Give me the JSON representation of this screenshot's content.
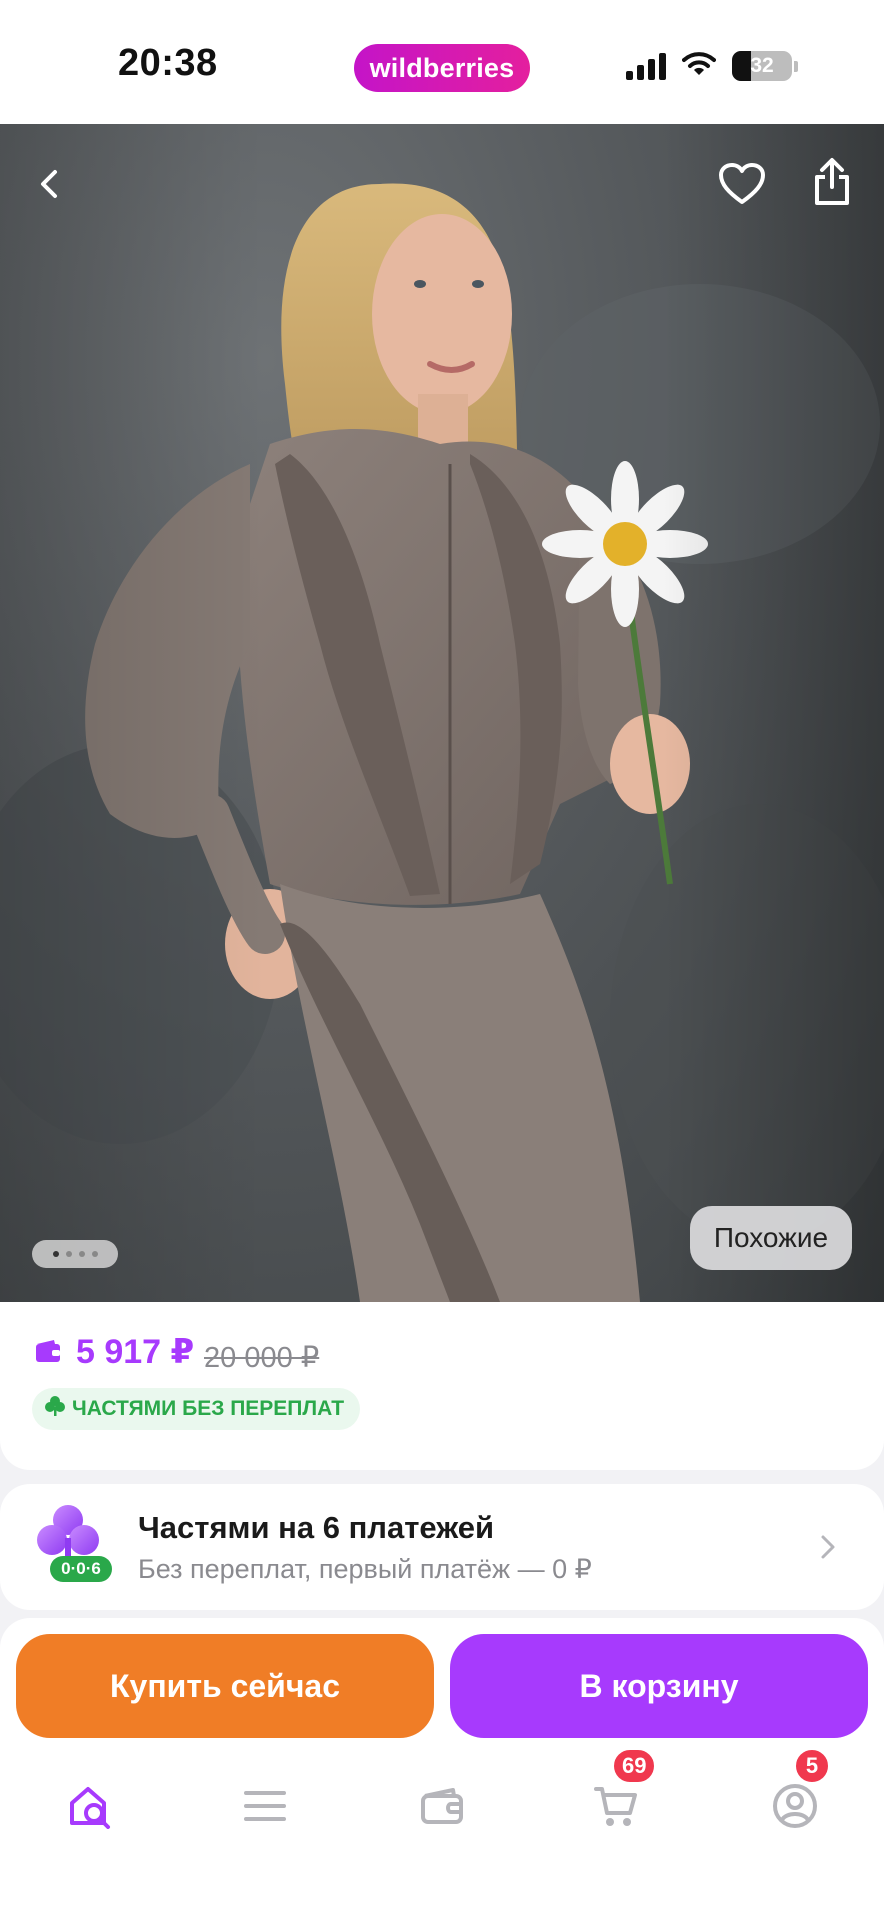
{
  "status_bar": {
    "time": "20:38",
    "brand": "wildberries",
    "battery": "32",
    "battery_level_fraction": 0.32,
    "icons": [
      "signal-icon",
      "wifi-icon",
      "battery-icon"
    ]
  },
  "hero": {
    "image_alt": "photo",
    "similar_label": "Похожие",
    "page_indicator": {
      "count": 4,
      "active": 1
    },
    "icons": [
      "back-icon",
      "heart-icon",
      "share-icon"
    ]
  },
  "price": {
    "current": "5 917 ₽",
    "old": "20 000 ₽",
    "installments_badge": "ЧАСТЯМИ БЕЗ ПЕРЕПЛАТ",
    "icons": [
      "wallet-icon",
      "clover-icon"
    ]
  },
  "split": {
    "badge": "0·0·6",
    "title": "Частями на 6 платежей",
    "subtitle": "Без переплат, первый платёж — 0 ₽",
    "icons": [
      "clover-icon",
      "chevron-right-icon"
    ]
  },
  "actions": {
    "buy_now": "Купить сейчас",
    "add_to_cart": "В корзину"
  },
  "tabbar": {
    "items": [
      {
        "name": "home-search",
        "icon": "home-search-icon"
      },
      {
        "name": "catalog",
        "icon": "menu-icon"
      },
      {
        "name": "wallet",
        "icon": "wallet-icon"
      },
      {
        "name": "cart",
        "icon": "cart-icon",
        "badge": "69"
      },
      {
        "name": "profile",
        "icon": "profile-icon",
        "badge": "5"
      }
    ]
  },
  "colors": {
    "brand_pink": "#cb11ab",
    "accent_purple": "#a73afd",
    "buy_orange": "#f07d26",
    "green": "#2aa84a",
    "badge_red": "#f0384e"
  }
}
